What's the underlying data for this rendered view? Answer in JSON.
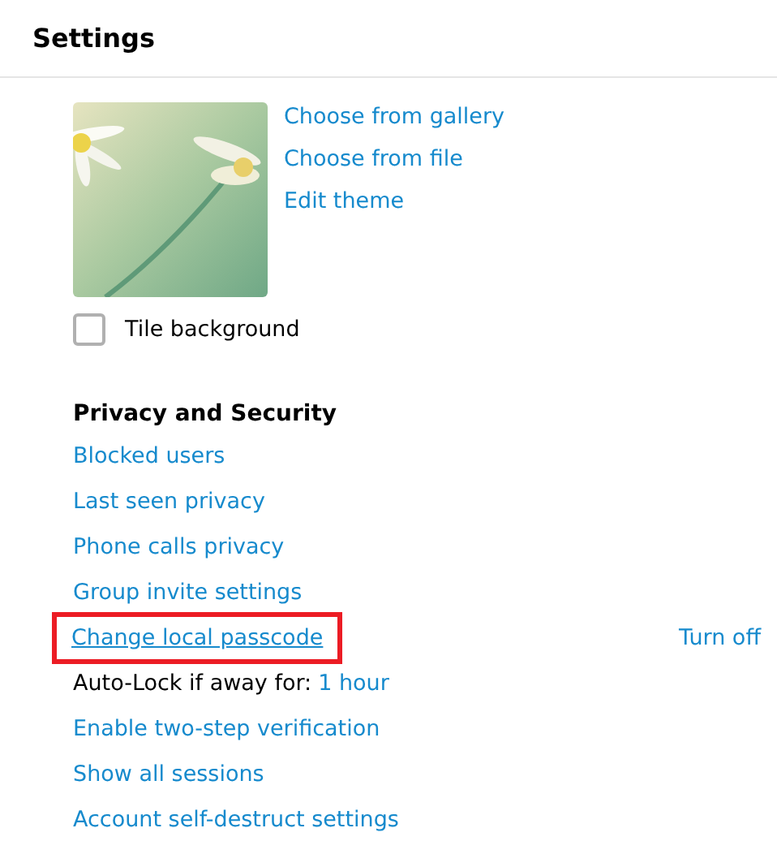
{
  "header": {
    "title": "Settings"
  },
  "background": {
    "actions": [
      "Choose from gallery",
      "Choose from file",
      "Edit theme"
    ],
    "tile": {
      "label": "Tile background",
      "checked": false
    }
  },
  "privacy": {
    "title": "Privacy and Security",
    "items": [
      {
        "kind": "link",
        "label": "Blocked users",
        "hovered": false,
        "highlighted": false
      },
      {
        "kind": "link",
        "label": "Last seen privacy",
        "hovered": false,
        "highlighted": false
      },
      {
        "kind": "link",
        "label": "Phone calls privacy",
        "hovered": false,
        "highlighted": false
      },
      {
        "kind": "link",
        "label": "Group invite settings",
        "hovered": false,
        "highlighted": false
      },
      {
        "kind": "link",
        "label": "Change local passcode",
        "hovered": true,
        "highlighted": true,
        "action": "Turn off"
      },
      {
        "kind": "setting",
        "label": "Auto-Lock if away for:",
        "value": "1 hour"
      },
      {
        "kind": "link",
        "label": "Enable two-step verification",
        "hovered": false,
        "highlighted": false
      },
      {
        "kind": "link",
        "label": "Show all sessions",
        "hovered": false,
        "highlighted": false
      },
      {
        "kind": "link",
        "label": "Account self-destruct settings",
        "hovered": false,
        "highlighted": false
      }
    ]
  }
}
